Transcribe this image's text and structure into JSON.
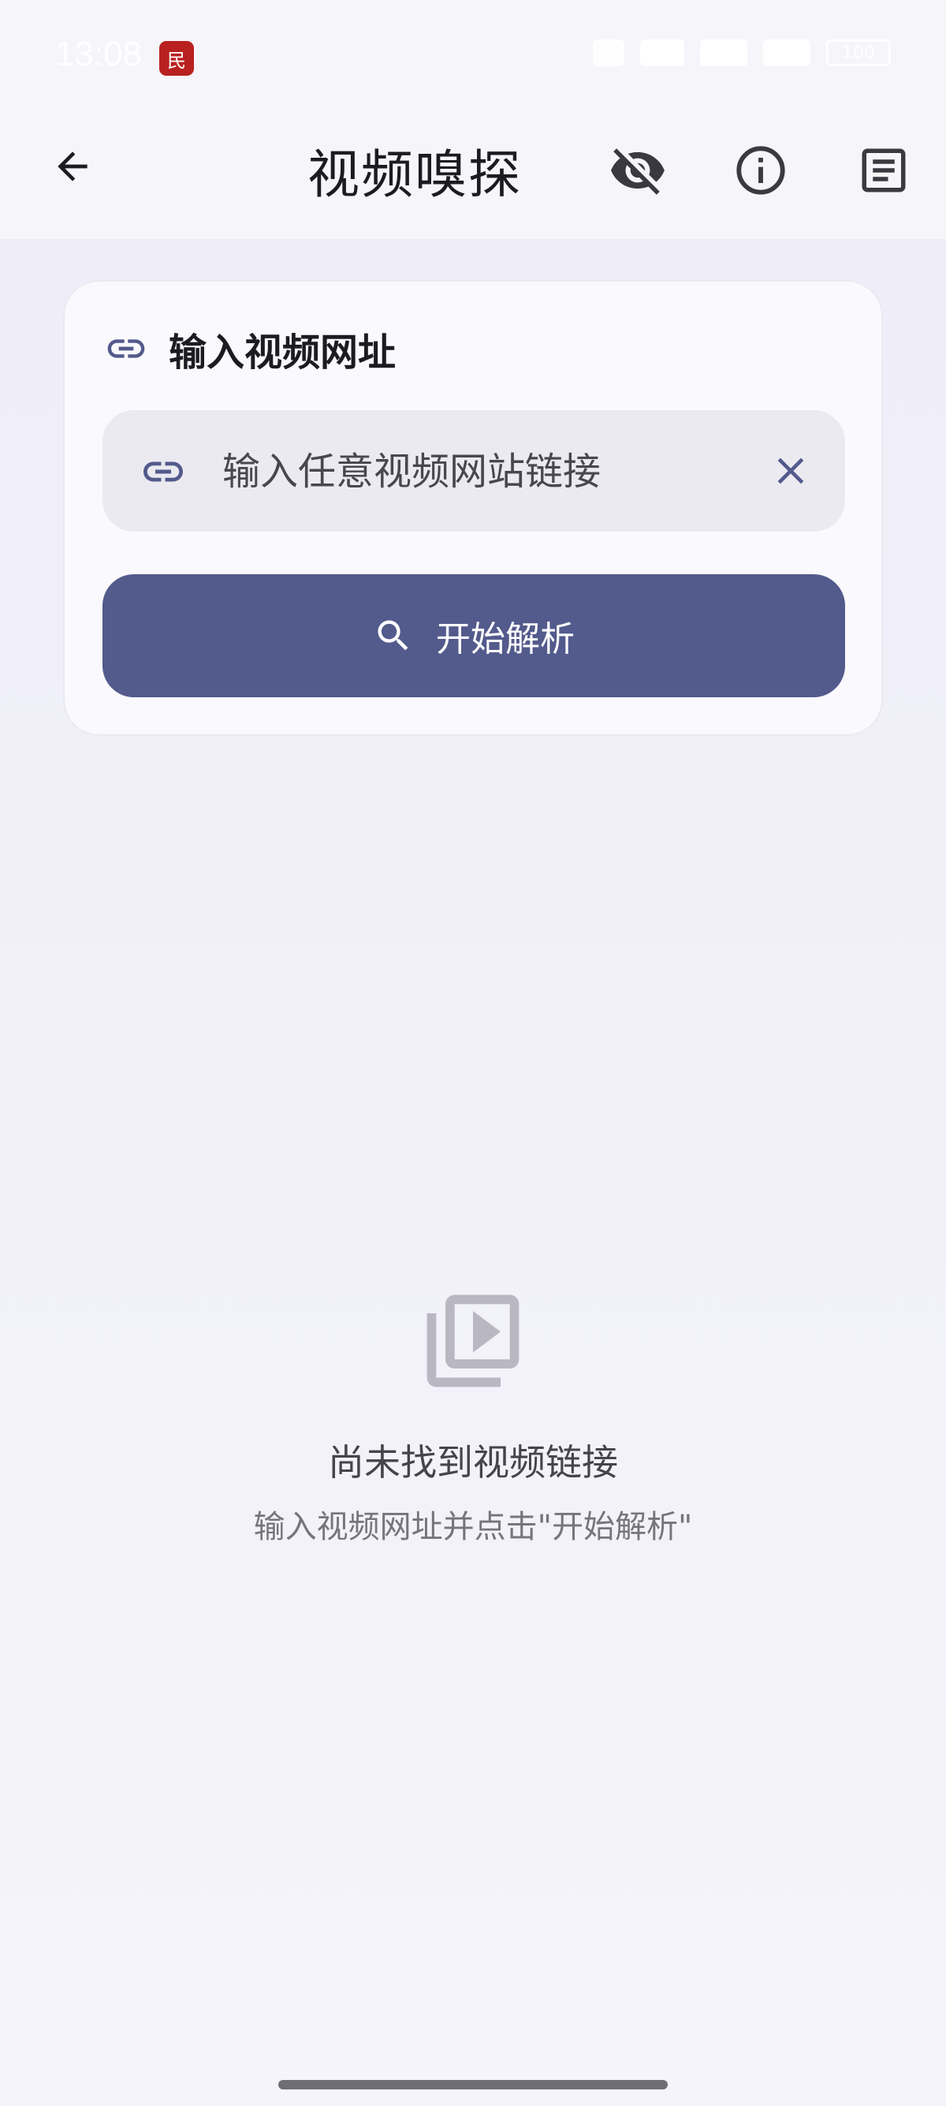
{
  "status_bar": {
    "time": "13:08",
    "app_badge": "民",
    "battery": "100"
  },
  "app_bar": {
    "title": "视频嗅探",
    "back_icon": "arrow-left-icon",
    "actions": [
      "visibility-off-icon",
      "info-icon",
      "article-icon"
    ]
  },
  "input_card": {
    "title": "输入视频网址",
    "placeholder": "输入任意视频网站链接",
    "value": "",
    "submit_label": "开始解析"
  },
  "empty_state": {
    "title": "尚未找到视频链接",
    "subtitle": "输入视频网址并点击\"开始解析\""
  },
  "colors": {
    "primary": "#535a8c",
    "background": "#f1f0f9",
    "card": "#faf9fd"
  }
}
